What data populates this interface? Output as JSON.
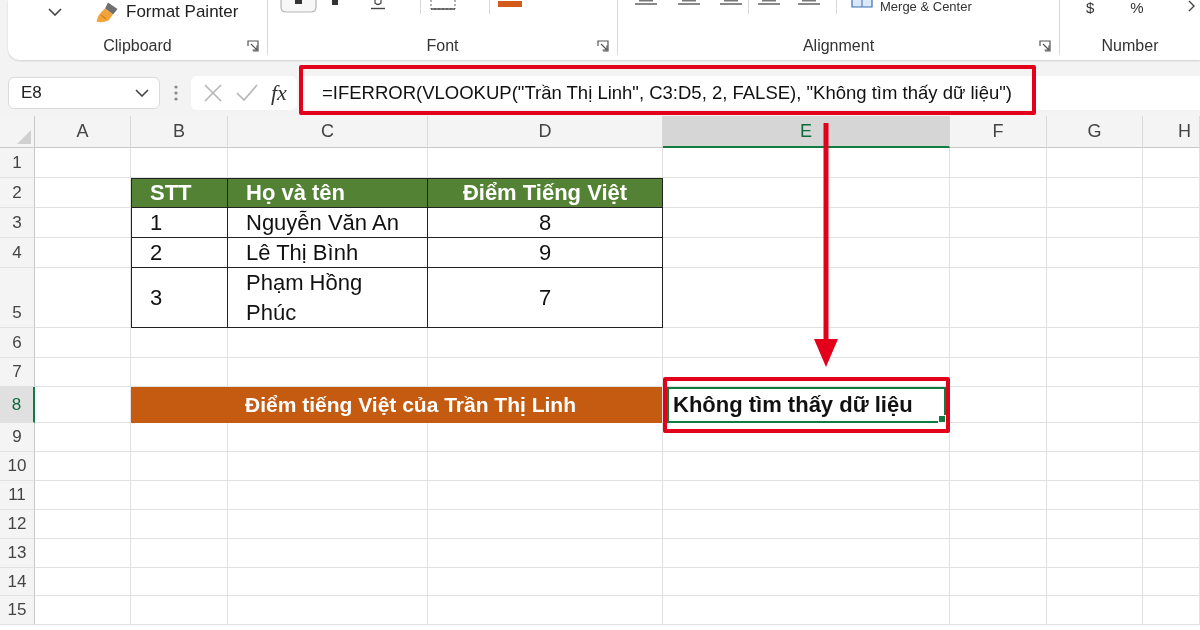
{
  "ribbon": {
    "groups": [
      {
        "kind": "clipboard",
        "label": "Clipboard",
        "button": "Format Painter"
      },
      {
        "kind": "font",
        "label": "Font"
      },
      {
        "kind": "alignment",
        "label": "Alignment",
        "button": "Merge & Center"
      },
      {
        "kind": "number",
        "label": "Number",
        "symbols": [
          "$",
          "%"
        ]
      }
    ]
  },
  "formula_bar": {
    "name_box": "E8",
    "function_button": "fx",
    "formula": "=IFERROR(VLOOKUP(\"Trần Thị Linh\", C3:D5, 2, FALSE), \"Không tìm thấy dữ liệu\")",
    "highlighted": true
  },
  "sheet": {
    "columns": [
      {
        "label": "A",
        "selected": false
      },
      {
        "label": "B",
        "selected": false
      },
      {
        "label": "C",
        "selected": false
      },
      {
        "label": "D",
        "selected": false
      },
      {
        "label": "E",
        "selected": true
      },
      {
        "label": "F",
        "selected": false
      },
      {
        "label": "G",
        "selected": false
      },
      {
        "label": "H",
        "selected": false
      }
    ],
    "rows": [
      {
        "label": "1",
        "selected": false
      },
      {
        "label": "2",
        "selected": false
      },
      {
        "label": "3",
        "selected": false
      },
      {
        "label": "4",
        "selected": false
      },
      {
        "label": "5",
        "selected": false
      },
      {
        "label": "6",
        "selected": false
      },
      {
        "label": "7",
        "selected": false
      },
      {
        "label": "8",
        "selected": true
      },
      {
        "label": "9",
        "selected": false
      },
      {
        "label": "10",
        "selected": false
      },
      {
        "label": "11",
        "selected": false
      },
      {
        "label": "12",
        "selected": false
      },
      {
        "label": "13",
        "selected": false
      },
      {
        "label": "14",
        "selected": false
      },
      {
        "label": "15",
        "selected": false
      }
    ],
    "table": {
      "header": [
        "STT",
        "Họ và tên",
        "Điểm Tiếng Việt"
      ],
      "rows": [
        [
          "1",
          "Nguyễn Văn An",
          "8"
        ],
        [
          "2",
          "Lê Thị Bình",
          "9"
        ],
        [
          "3",
          "Phạm Hồng Phúc",
          "7"
        ]
      ]
    },
    "summary": {
      "label": "Điểm tiếng Việt của Trần Thị Linh",
      "result": "Không tìm thấy dữ liệu",
      "active": true,
      "highlighted": true
    }
  }
}
